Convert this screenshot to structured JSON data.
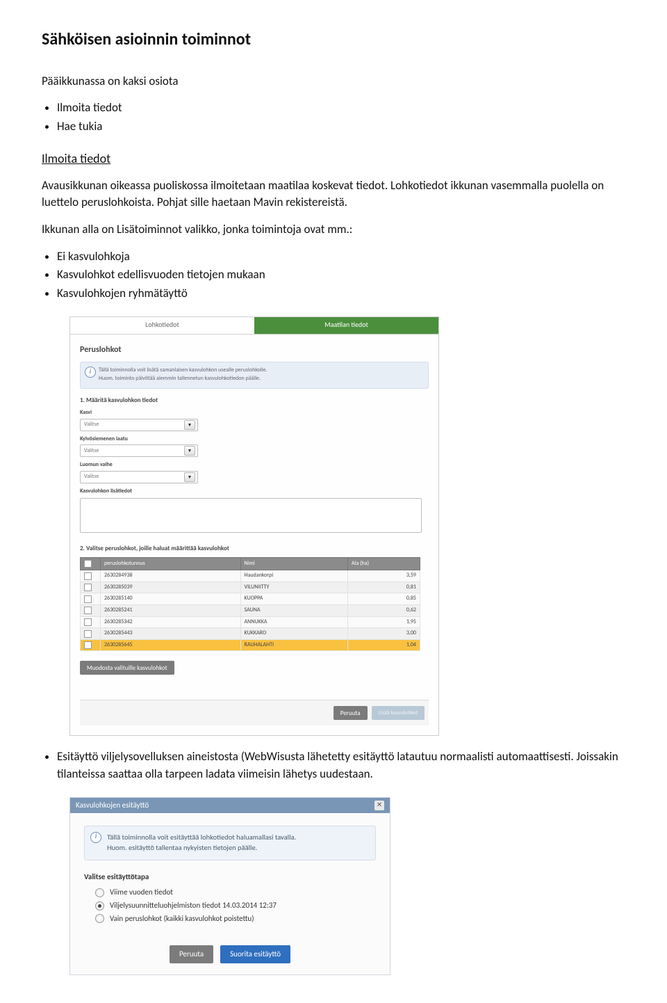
{
  "doc": {
    "heading": "Sähköisen asioinnin toiminnot",
    "intro1": "Pääikkunassa on kaksi osiota",
    "mainBullets": [
      "Ilmoita tiedot",
      "Hae tukia"
    ],
    "sectionTitle": "Ilmoita tiedot",
    "p1": "Avausikkunan oikeassa puoliskossa ilmoitetaan maatilaa koskevat tiedot. Lohkotiedot ikkunan vasemmalla puolella on luettelo peruslohkoista. Pohjat sille haetaan Mavin rekistereistä.",
    "p2": "Ikkunan alla on Lisätoiminnot valikko, jonka toimintoja ovat mm.:",
    "subBullets": [
      "Ei kasvulohkoja",
      "Kasvulohkot edellisvuoden tietojen mukaan",
      "Kasvulohkojen ryhmätäyttö"
    ],
    "afterShot1": "Esitäyttö viljelysovelluksen aineistosta (WebWisusta lähetetty esitäyttö latautuu normaalisti automaattisesti. Joissakin tilanteissa saattaa olla tarpeen ladata viimeisin lähetys uudestaan."
  },
  "shot1": {
    "tabLeft": "Lohkotiedot",
    "tabRight": "Maatilan tiedot",
    "panelTitle": "Peruslohkot",
    "infoLine1": "Tällä toiminnolla voit lisätä samanlaisen kasvulohkon usealle peruslohkolle.",
    "infoLine2": "Huom. toiminto päivittää aiemmin tallennetun kasvulohkotiedon päälle.",
    "step1": "1. Määritä kasvulohkon tiedot",
    "lblKasvi": "Kasvi",
    "lblKylvo": "Kylvösiemenen laatu",
    "lblLuomu": "Luomun vaihe",
    "lblLisa": "Kasvulohkon lisätiedot",
    "valitse": "Valitse",
    "step2": "2. Valitse peruslohkot, joille haluat määrittää kasvulohkot",
    "col1": "peruslohkotunnus",
    "col2": "Nimi",
    "col3": "Ala (ha)",
    "rows": [
      {
        "id": "2630284938",
        "name": "Haudankorpi",
        "area": "3,59"
      },
      {
        "id": "2630285039",
        "name": "VILUNIITTY",
        "area": "0,81"
      },
      {
        "id": "2630285140",
        "name": "KUOPPA",
        "area": "0,85"
      },
      {
        "id": "2630285241",
        "name": "SAUNA",
        "area": "0,62"
      },
      {
        "id": "2630285342",
        "name": "ANNUKKA",
        "area": "1,95"
      },
      {
        "id": "2630285443",
        "name": "KUKKARO",
        "area": "3,00"
      },
      {
        "id": "2630285645",
        "name": "RAUHALAHTI",
        "area": "1,04"
      }
    ],
    "btnMuodosta": "Muodosta valituille kasvulohkot",
    "btnPeruuta": "Peruuta",
    "btnLisaa1": "Lisää",
    "btnLisaa2": "kasvulohkot"
  },
  "shot2": {
    "title": "Kasvulohkojen esitäyttö",
    "infoLine1": "Tällä toiminnolla voit esitäyttää lohkotiedot haluamallasi tavalla.",
    "infoLine2": "Huom. esitäyttö tallentaa nykyisten tietojen päälle.",
    "heading": "Valitse esitäyttötapa",
    "opt1": "Viime vuoden tiedot",
    "opt2": "Viljelysuunnitteluohjelmiston tiedot 14.03.2014 12:37",
    "opt3": "Vain peruslohkot (kaikki kasvulohkot poistettu)",
    "btnPeruuta": "Peruuta",
    "btnSuorita": "Suorita esitäyttö"
  }
}
